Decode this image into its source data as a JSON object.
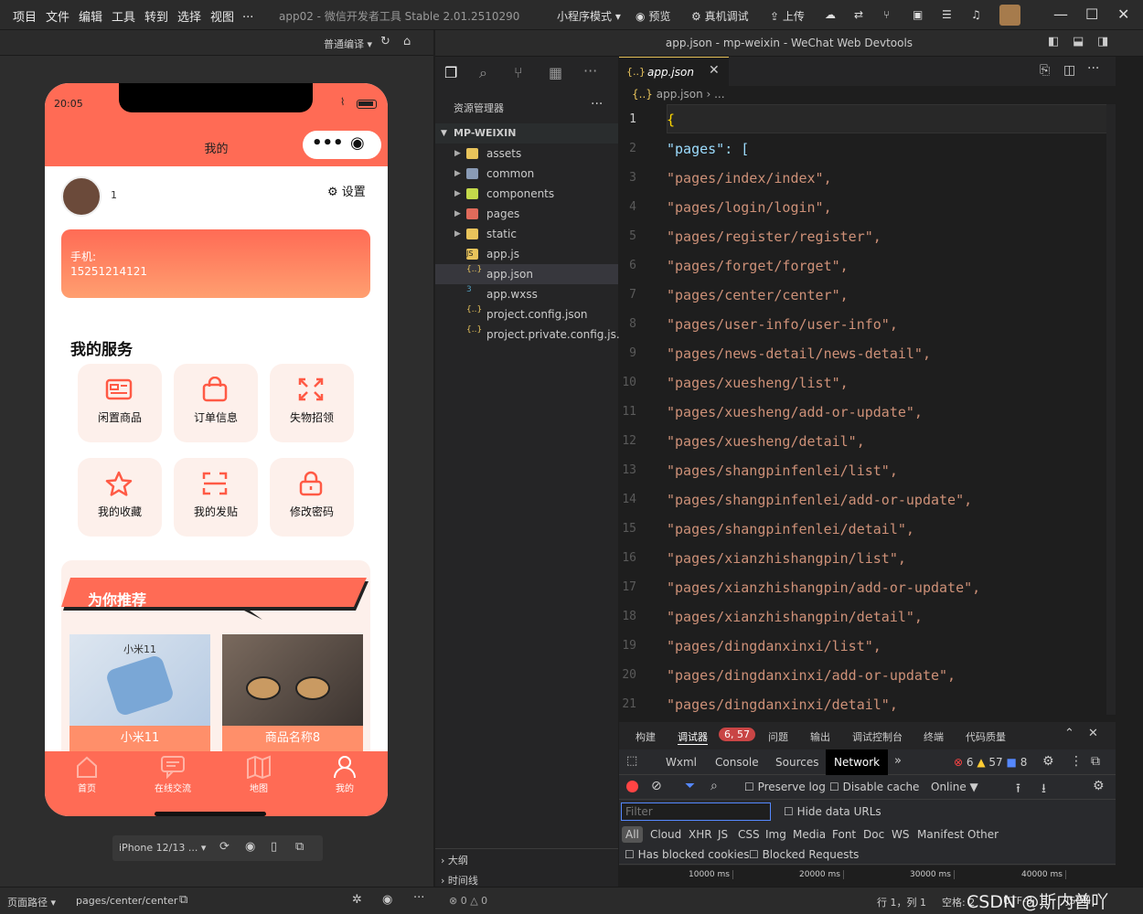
{
  "titlebar": {
    "menus": [
      "项目",
      "文件",
      "编辑",
      "工具",
      "转到",
      "选择",
      "视图",
      "..."
    ],
    "app_title": "app02 - 微信开发者工具 Stable 2.01.2510290",
    "mode": "小程序模式",
    "preview": "预览",
    "real_debug": "真机调试",
    "upload": "上传"
  },
  "sim_toolbar": {
    "compile_mode": "普通编译"
  },
  "phone": {
    "time": "20:05",
    "nav_title": "我的",
    "user_name": "1",
    "settings_label": "设置",
    "phone_label": "手机:",
    "phone_number": "15251214121",
    "services_title": "我的服务",
    "services": [
      {
        "label": "闲置商品",
        "icon": "card-icon"
      },
      {
        "label": "订单信息",
        "icon": "bag-icon"
      },
      {
        "label": "失物招领",
        "icon": "expand-icon"
      },
      {
        "label": "我的收藏",
        "icon": "star-icon"
      },
      {
        "label": "我的发贴",
        "icon": "scan-icon"
      },
      {
        "label": "修改密码",
        "icon": "lock-icon"
      }
    ],
    "recommend_title": "为你推荐",
    "products": [
      {
        "name": "小米11",
        "image_text": "小米11"
      },
      {
        "name": "商品名称8"
      }
    ],
    "tabs": [
      {
        "label": "首页",
        "icon": "home-icon"
      },
      {
        "label": "在线交流",
        "icon": "chat-icon"
      },
      {
        "label": "地图",
        "icon": "map-icon"
      },
      {
        "label": "我的",
        "icon": "user-icon"
      }
    ],
    "accent": "#ff6b55"
  },
  "device": {
    "model": "iPhone 12/13 ..."
  },
  "editor_window_title": "app.json - mp-weixin - WeChat Web Devtools",
  "explorer": {
    "title": "资源管理器",
    "root": "MP-WEIXIN",
    "items": [
      {
        "name": "assets",
        "type": "folder",
        "color": "#e8c35b"
      },
      {
        "name": "common",
        "type": "folder",
        "color": "#8a9bb5"
      },
      {
        "name": "components",
        "type": "folder",
        "color": "#c4d94b"
      },
      {
        "name": "pages",
        "type": "folder",
        "color": "#e06b5b"
      },
      {
        "name": "static",
        "type": "folder",
        "color": "#e8c35b"
      },
      {
        "name": "app.js",
        "type": "js",
        "color": "#e8c35b"
      },
      {
        "name": "app.json",
        "type": "json",
        "color": "#e8c35b",
        "selected": true
      },
      {
        "name": "app.wxss",
        "type": "css",
        "color": "#519aba"
      },
      {
        "name": "project.config.json",
        "type": "json",
        "color": "#e8c35b"
      },
      {
        "name": "project.private.config.js...",
        "type": "json",
        "color": "#e8c35b"
      }
    ],
    "outline": "大纲",
    "timeline": "时间线"
  },
  "editor": {
    "tab": "app.json",
    "breadcrumb": "app.json",
    "lines": [
      "{",
      "  \"pages\": [",
      "    \"pages/index/index\",",
      "    \"pages/login/login\",",
      "    \"pages/register/register\",",
      "    \"pages/forget/forget\",",
      "    \"pages/center/center\",",
      "    \"pages/user-info/user-info\",",
      "    \"pages/news-detail/news-detail\",",
      "    \"pages/xuesheng/list\",",
      "    \"pages/xuesheng/add-or-update\",",
      "    \"pages/xuesheng/detail\",",
      "    \"pages/shangpinfenlei/list\",",
      "    \"pages/shangpinfenlei/add-or-update\",",
      "    \"pages/shangpinfenlei/detail\",",
      "    \"pages/xianzhishangpin/list\",",
      "    \"pages/xianzhishangpin/add-or-update\",",
      "    \"pages/xianzhishangpin/detail\",",
      "    \"pages/dingdanxinxi/list\",",
      "    \"pages/dingdanxinxi/add-or-update\",",
      "    \"pages/dingdanxinxi/detail\","
    ]
  },
  "devtools": {
    "panel_tabs": [
      "构建",
      "调试器",
      "问题",
      "输出",
      "调试控制台",
      "终端",
      "代码质量"
    ],
    "debugger_badge": "6, 57",
    "tabs": [
      "Wxml",
      "Console",
      "Sources",
      "Network"
    ],
    "active_tab": "Network",
    "errors": "6",
    "warnings": "57",
    "infos": "8",
    "preserve_log": "Preserve log",
    "disable_cache": "Disable cache",
    "throttle": "Online",
    "filter_placeholder": "Filter",
    "hide_data_urls": "Hide data URLs",
    "types": [
      "All",
      "Cloud",
      "XHR",
      "JS",
      "CSS",
      "Img",
      "Media",
      "Font",
      "Doc",
      "WS",
      "Manifest",
      "Other"
    ],
    "blocked_cookies": "Has blocked cookies",
    "blocked_requests": "Blocked Requests",
    "timeline": [
      "10000 ms",
      "20000 ms",
      "30000 ms",
      "40000 ms"
    ]
  },
  "statusbar": {
    "page_path_label": "页面路径",
    "page_path": "pages/center/center",
    "problems": "0",
    "warnings": "0",
    "cursor": "行 1，列 1",
    "spaces": "空格: 2",
    "encoding": "UTF-8",
    "language": "JSON",
    "watermark": "CSDN @斯内普吖"
  }
}
